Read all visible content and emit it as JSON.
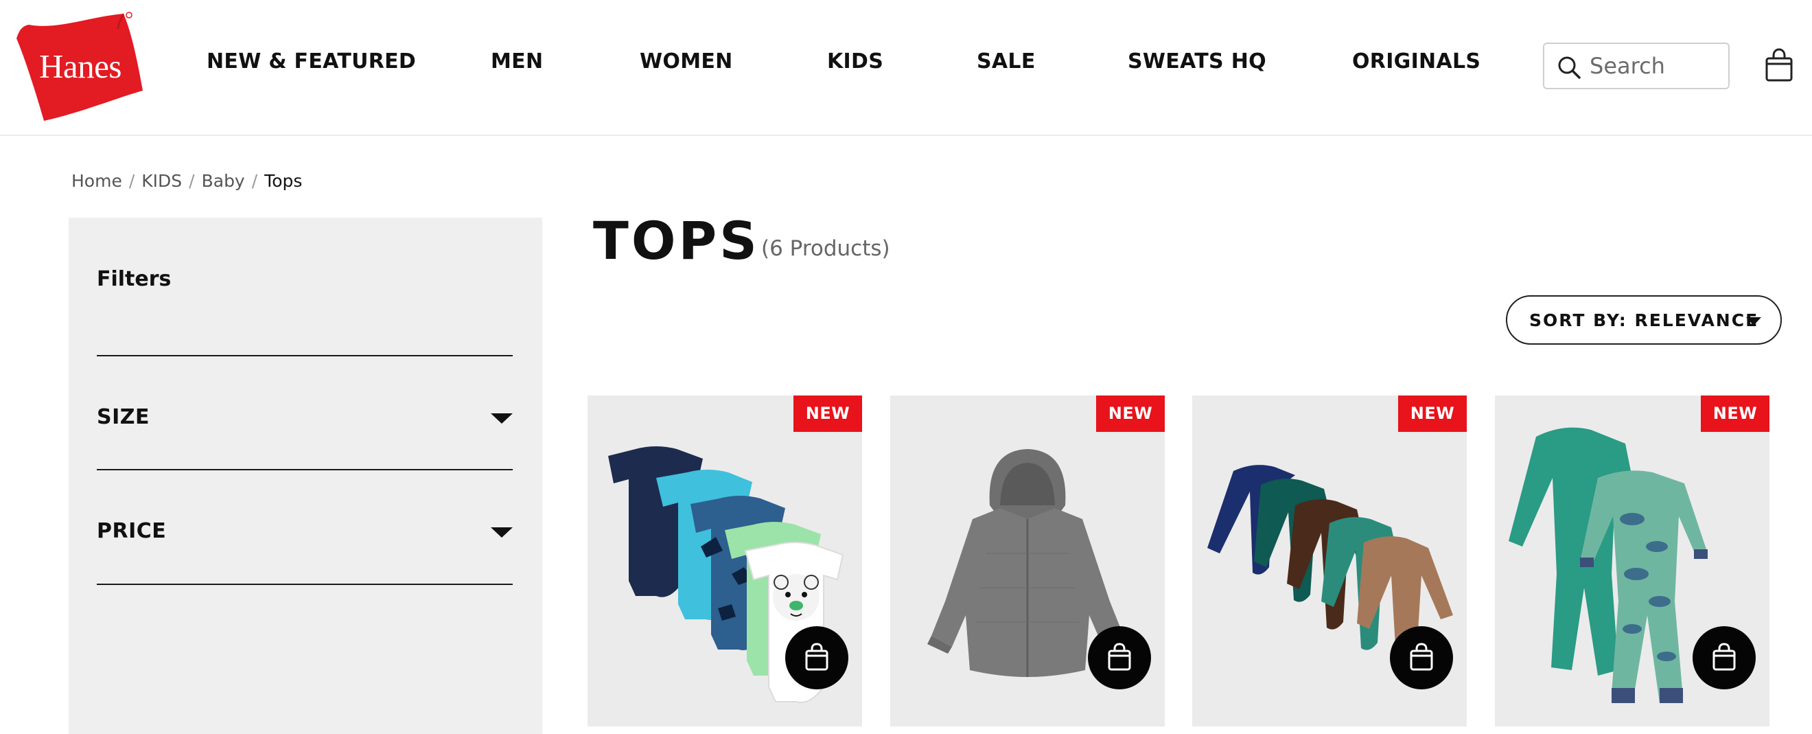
{
  "brand": {
    "logo_text": "Hanes",
    "logo_color": "#e31b23"
  },
  "nav": {
    "items": [
      {
        "label": "NEW & FEATURED"
      },
      {
        "label": "MEN"
      },
      {
        "label": "WOMEN"
      },
      {
        "label": "KIDS"
      },
      {
        "label": "SALE"
      },
      {
        "label": "SWEATS HQ"
      },
      {
        "label": "ORIGINALS"
      }
    ]
  },
  "search": {
    "placeholder": "Search",
    "icon": "search-icon"
  },
  "cart": {
    "icon": "shopping-bag-icon"
  },
  "breadcrumb": {
    "items": [
      {
        "label": "Home"
      },
      {
        "label": "KIDS"
      },
      {
        "label": "Baby"
      }
    ],
    "current": "Tops",
    "separator": "/"
  },
  "filters": {
    "title": "Filters",
    "groups": [
      {
        "label": "SIZE"
      },
      {
        "label": "PRICE"
      }
    ]
  },
  "page": {
    "title": "TOPS",
    "count_text": "(6 Products)"
  },
  "sort": {
    "label": "SORT BY: RELEVANCE"
  },
  "products": [
    {
      "badge": "NEW",
      "image": "baby-bodysuits-5-pack"
    },
    {
      "badge": "NEW",
      "image": "grey-hooded-zip-jacket"
    },
    {
      "badge": "NEW",
      "image": "long-sleeve-bodysuits-5-pack"
    },
    {
      "badge": "NEW",
      "image": "sleep-and-play-2-pack"
    }
  ],
  "colors": {
    "accent_red": "#e8131b",
    "filter_bg": "#efefef",
    "text": "#111111"
  }
}
